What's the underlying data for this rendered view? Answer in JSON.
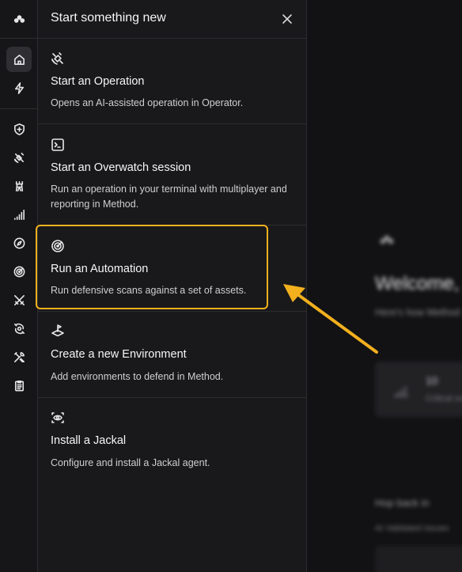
{
  "panel": {
    "title": "Start something new",
    "options": [
      {
        "icon": "satellite-icon",
        "title": "Start an Operation",
        "description": "Opens an AI-assisted operation in Operator."
      },
      {
        "icon": "terminal-icon",
        "title": "Start an Overwatch session",
        "description": "Run an operation in your terminal with multiplayer and reporting in Method."
      },
      {
        "icon": "radar-icon",
        "title": "Run an Automation",
        "description": "Run defensive scans against a set of assets."
      },
      {
        "icon": "layers-flag-icon",
        "title": "Create a new Environment",
        "description": "Add environments to defend in Method."
      },
      {
        "icon": "eye-scan-icon",
        "title": "Install a Jackal",
        "description": "Configure and install a Jackal agent."
      }
    ]
  },
  "rail": {
    "items": [
      "logo-icon",
      "home-icon",
      "lightning-icon",
      "shield-plus-icon",
      "satellite-icon",
      "tower-icon",
      "signal-bars-icon",
      "compass-icon",
      "radar-icon",
      "crossed-swords-icon",
      "orbit-icon",
      "tools-icon",
      "clipboard-icon"
    ],
    "active": "home-icon"
  },
  "background": {
    "welcome": "Welcome, J",
    "subtitle": "Here's how Method",
    "card_value": "10",
    "card_label": "Critical vulns",
    "jump_title": "Hop back in",
    "jump_sub": "AI Validated Issues"
  },
  "colors": {
    "highlight": "#f2b01e",
    "panel_bg": "#19191b",
    "rail_bg": "#161618"
  }
}
